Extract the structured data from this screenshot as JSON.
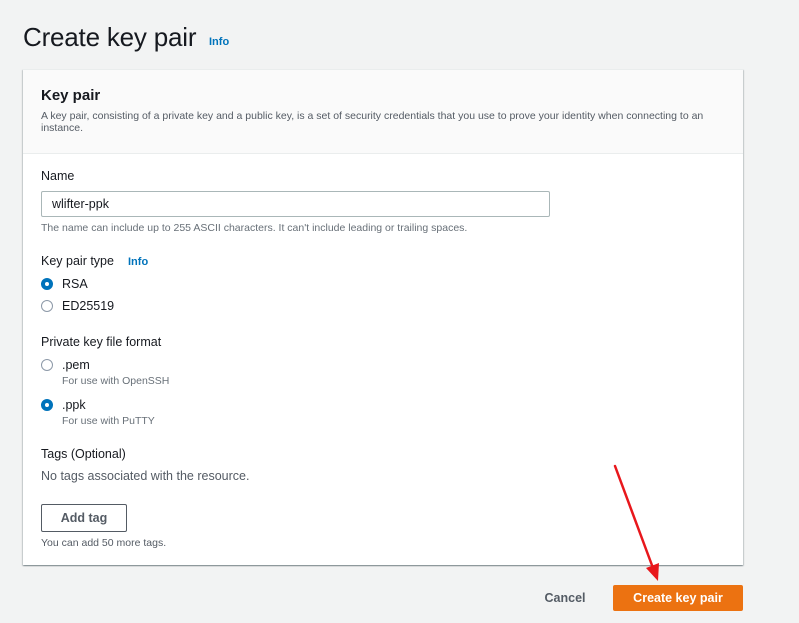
{
  "page": {
    "title": "Create key pair",
    "info_label": "Info"
  },
  "panel": {
    "title": "Key pair",
    "description": "A key pair, consisting of a private key and a public key, is a set of security credentials that you use to prove your identity when connecting to an instance."
  },
  "name_field": {
    "label": "Name",
    "value": "wlifter-ppk",
    "hint": "The name can include up to 255 ASCII characters. It can't include leading or trailing spaces."
  },
  "key_type": {
    "label": "Key pair type",
    "info_label": "Info",
    "selected": "RSA",
    "options": [
      {
        "label": "RSA",
        "checked": true
      },
      {
        "label": "ED25519",
        "checked": false
      }
    ]
  },
  "file_format": {
    "label": "Private key file format",
    "selected": ".ppk",
    "options": [
      {
        "label": ".pem",
        "sub": "For use with OpenSSH",
        "checked": false
      },
      {
        "label": ".ppk",
        "sub": "For use with PuTTY",
        "checked": true
      }
    ]
  },
  "tags": {
    "label": "Tags (Optional)",
    "empty_text": "No tags associated with the resource.",
    "add_button": "Add tag",
    "limit_hint": "You can add 50 more tags."
  },
  "footer": {
    "cancel_label": "Cancel",
    "create_label": "Create key pair"
  },
  "colors": {
    "primary": "#ec7211",
    "link": "#0073bb",
    "annotation_arrow": "#e8171c"
  },
  "icons": {
    "annotation": "red-arrow-icon"
  }
}
